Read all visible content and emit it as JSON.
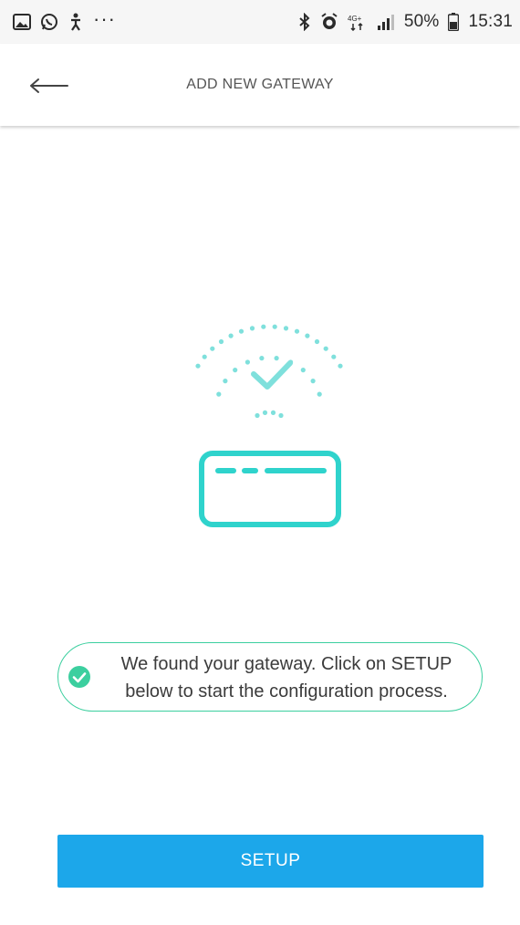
{
  "status_bar": {
    "left_icons": [
      "gallery-icon",
      "whatsapp-icon",
      "accessibility-icon",
      "more-dots-icon"
    ],
    "dots": "···",
    "right_icons": [
      "bluetooth-icon",
      "alarm-icon",
      "network-4g-icon",
      "signal-icon",
      "battery-icon"
    ],
    "network_label": "4G+",
    "battery": "50%",
    "time": "15:31"
  },
  "header": {
    "back_icon": "arrow-left-icon",
    "title": "ADD NEW GATEWAY"
  },
  "illustration": {
    "icons": [
      "wifi-check-icon",
      "gateway-device-icon"
    ],
    "accent_color": "#2fd3cc"
  },
  "message": {
    "icon": "check-circle-icon",
    "line1": "We found your gateway. Click on SETUP",
    "line2": "below to start the configuration process.",
    "border_color": "#3ccf9f"
  },
  "actions": {
    "setup_label": "SETUP",
    "setup_color": "#1ca7ea"
  }
}
